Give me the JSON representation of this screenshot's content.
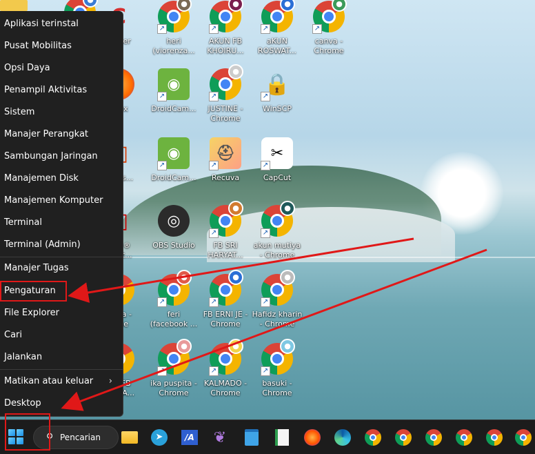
{
  "context_menu": {
    "items": [
      {
        "label": "Aplikasi terinstal"
      },
      {
        "label": "Pusat Mobilitas"
      },
      {
        "label": "Opsi Daya"
      },
      {
        "label": "Penampil Aktivitas"
      },
      {
        "label": "Sistem"
      },
      {
        "label": "Manajer Perangkat"
      },
      {
        "label": "Sambungan Jaringan"
      },
      {
        "label": "Manajemen Disk"
      },
      {
        "label": "Manajemen Komputer"
      },
      {
        "label": "Terminal"
      },
      {
        "label": "Terminal (Admin)"
      },
      {
        "label": "Manajer Tugas"
      },
      {
        "label": "Pengaturan"
      },
      {
        "label": "File Explorer"
      },
      {
        "label": "Cari"
      },
      {
        "label": "Jalankan"
      },
      {
        "label": "Matikan atau keluar"
      },
      {
        "label": "Desktop"
      }
    ],
    "submenu_arrow": "›"
  },
  "desktop": {
    "icons": [
      {
        "label": "...aner",
        "icon": "ccleaner-icon"
      },
      {
        "label": "heri\n(viorenza...",
        "icon": "chrome-icon"
      },
      {
        "label": "AKUN FB\nKHOIRU...",
        "icon": "chrome-icon"
      },
      {
        "label": "aKUN\nROSWAT...",
        "icon": "chrome-icon"
      },
      {
        "label": "canva -\nChrome",
        "icon": "chrome-icon"
      },
      {
        "label": "...fox",
        "icon": "firefox-icon"
      },
      {
        "label": "DroidCam...",
        "icon": "droidcam-icon"
      },
      {
        "label": "JUSTINE -\nChrome",
        "icon": "chrome-icon"
      },
      {
        "label": "WinSCP",
        "icon": "winscp-icon"
      },
      {
        "label": "..._Ins...",
        "icon": "office-icon"
      },
      {
        "label": "DroidCam...",
        "icon": "droidcam-icon"
      },
      {
        "label": "Recuva",
        "icon": "recuva-icon"
      },
      {
        "label": "CapCut",
        "icon": "capcut-icon"
      },
      {
        "label": "...ee®\n...net...",
        "icon": "office-icon"
      },
      {
        "label": "OBS Studio",
        "icon": "obs-icon"
      },
      {
        "label": "FB SRI\nHARYAT...",
        "icon": "chrome-icon"
      },
      {
        "label": "akun mutiya\n- Chrome",
        "icon": "chrome-icon"
      },
      {
        "label": "...riza -\n...me",
        "icon": "chrome-icon"
      },
      {
        "label": "feri\n(facebook ...",
        "icon": "chrome-icon"
      },
      {
        "label": "FB ERNI JE -\nChrome",
        "icon": "chrome-icon"
      },
      {
        "label": "Hafidz kharin\n- Chrome",
        "icon": "chrome-icon"
      },
      {
        "label": "...A FB\n...A KA...",
        "icon": "chrome-icon"
      },
      {
        "label": "ika puspita -\nChrome",
        "icon": "chrome-icon"
      },
      {
        "label": "KALMADO -\nChrome",
        "icon": "chrome-icon"
      },
      {
        "label": "basuki -\nChrome",
        "icon": "chrome-icon"
      }
    ]
  },
  "taskbar": {
    "search_label": "Pencarian",
    "apps": [
      "file-explorer-icon",
      "telegram-icon",
      "vscode-icon",
      "feather-icon",
      "notepad-icon",
      "notes-icon",
      "firefox-icon",
      "edge-icon",
      "chrome-icon",
      "chrome-icon",
      "chrome-icon",
      "chrome-icon",
      "chrome-icon",
      "chrome-icon"
    ]
  },
  "colors": {
    "menu_bg": "#202020",
    "taskbar_bg": "#1c1c1c",
    "annotation_red": "#e01818"
  }
}
